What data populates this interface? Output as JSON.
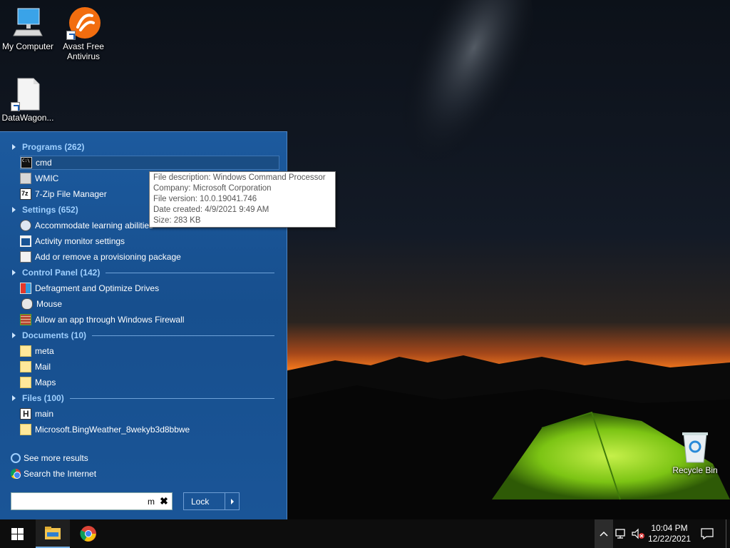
{
  "desktop": {
    "icons": [
      {
        "name": "my-computer",
        "label": "My Computer"
      },
      {
        "name": "avast",
        "label": "Avast Free Antivirus"
      },
      {
        "name": "datawagon",
        "label": "DataWagon..."
      },
      {
        "name": "recycle-bin",
        "label": "Recycle Bin"
      }
    ]
  },
  "start_menu": {
    "categories": [
      {
        "label": "Programs (262)",
        "items": [
          "cmd",
          "WMIC",
          "7-Zip File Manager"
        ]
      },
      {
        "label": "Settings (652)",
        "items": [
          "Accommodate learning abilities",
          "Activity monitor settings",
          "Add or remove a provisioning package"
        ]
      },
      {
        "label": "Control Panel (142)",
        "items": [
          "Defragment and Optimize Drives",
          "Mouse",
          "Allow an app through Windows Firewall"
        ]
      },
      {
        "label": "Documents (10)",
        "items": [
          "meta",
          "Mail",
          "Maps"
        ]
      },
      {
        "label": "Files (100)",
        "items": [
          "main",
          "Microsoft.BingWeather_8wekyb3d8bbwe"
        ]
      }
    ],
    "see_more": "See more results",
    "search_internet": "Search the Internet",
    "search_value": "m",
    "clear_symbol": "✖",
    "lock_label": "Lock"
  },
  "tooltip": {
    "lines": [
      "File description: Windows Command Processor",
      "Company: Microsoft Corporation",
      "File version: 10.0.19041.746",
      "Date created: 4/9/2021 9:49 AM",
      "Size: 283 KB"
    ]
  },
  "taskbar": {
    "time": "10:04 PM",
    "date": "12/22/2021"
  },
  "colors": {
    "start_menu_bg": "#1a5597",
    "category_text": "#9fd0ff",
    "taskbar_bg": "#0d0d0d"
  }
}
